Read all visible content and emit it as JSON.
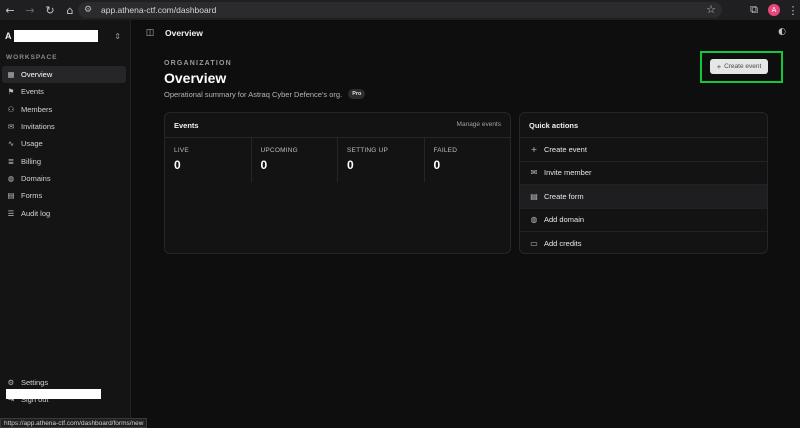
{
  "browser": {
    "back_icon": "arrow-left-icon",
    "url": "app.athena-ctf.com/dashboard",
    "profile_initial": "A",
    "status_url": "https://app.athena-ctf.com/dashboard/forms/new"
  },
  "sidebar": {
    "org_initial": "A",
    "section_label": "WORKSPACE",
    "items": [
      {
        "label": "Overview",
        "icon": "grid-icon",
        "active": true
      },
      {
        "label": "Events",
        "icon": "flag-icon"
      },
      {
        "label": "Members",
        "icon": "users-icon"
      },
      {
        "label": "Invitations",
        "icon": "mail-icon"
      },
      {
        "label": "Usage",
        "icon": "activity-icon"
      },
      {
        "label": "Billing",
        "icon": "database-icon"
      },
      {
        "label": "Domains",
        "icon": "globe-icon"
      },
      {
        "label": "Forms",
        "icon": "file-icon"
      },
      {
        "label": "Audit log",
        "icon": "list-icon"
      }
    ],
    "bottom": [
      {
        "label": "Settings",
        "icon": "gear-icon"
      },
      {
        "label": "Sign out",
        "icon": "sign-out-icon"
      }
    ]
  },
  "topbar": {
    "title": "Overview"
  },
  "page": {
    "eyebrow": "ORGANIZATION",
    "title": "Overview",
    "subtitle": "Operational summary for Astraq Cyber Defence's org.",
    "badge": "Pro",
    "create_button": "Create event",
    "highlight_color": "#16c63a"
  },
  "events": {
    "title": "Events",
    "manage_link": "Manage events",
    "stats": [
      {
        "label": "LIVE",
        "value": "0"
      },
      {
        "label": "UPCOMING",
        "value": "0"
      },
      {
        "label": "SETTING UP",
        "value": "0"
      },
      {
        "label": "FAILED",
        "value": "0"
      }
    ]
  },
  "quick_actions": {
    "title": "Quick actions",
    "items": [
      {
        "label": "Create event",
        "icon": "plus-icon"
      },
      {
        "label": "Invite member",
        "icon": "mail-icon"
      },
      {
        "label": "Create form",
        "icon": "clipboard-icon"
      },
      {
        "label": "Add domain",
        "icon": "globe-icon"
      },
      {
        "label": "Add credits",
        "icon": "card-icon"
      }
    ]
  }
}
